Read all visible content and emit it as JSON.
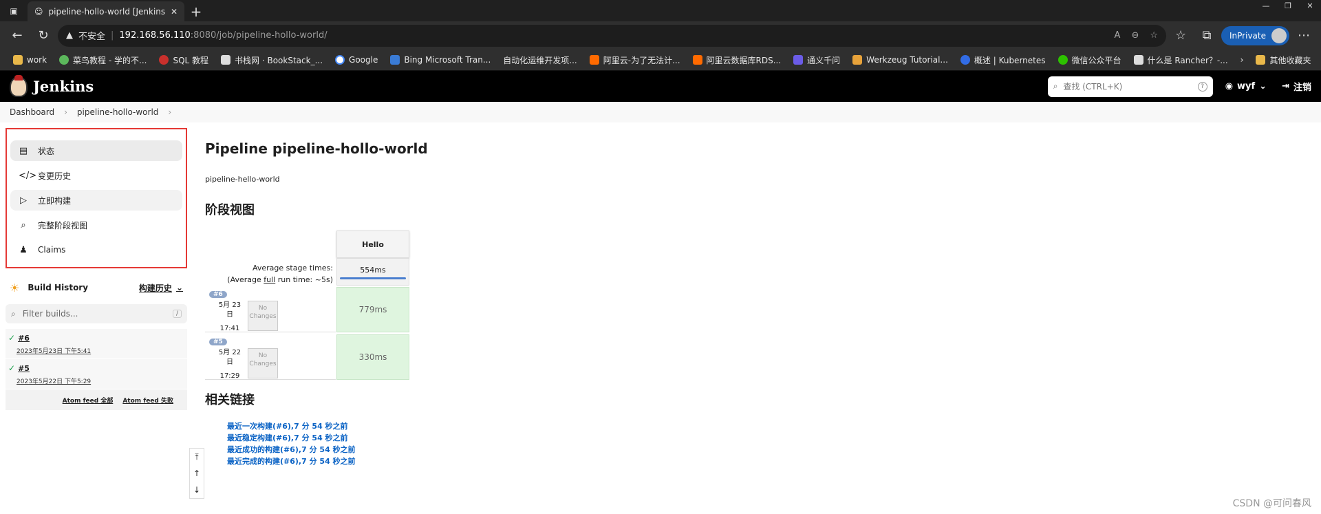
{
  "browser": {
    "tab_title": "pipeline-hollo-world [Jenkins]",
    "security_label": "不安全",
    "url_host": "192.168.56.110",
    "url_rest": ":8080/job/pipeline-hollo-world/",
    "inprivate": "InPrivate",
    "bookmarks": [
      "work",
      "菜鸟教程 - 学的不...",
      "SQL 教程",
      "书栈网 · BookStack_...",
      "Google",
      "Bing Microsoft Tran...",
      "自动化运维开发项...",
      "阿里云-为了无法计...",
      "阿里云数据库RDS...",
      "通义千问",
      "Werkzeug Tutorial...",
      "概述 | Kubernetes",
      "微信公众平台",
      "什么是 Rancher？-...",
      "其他收藏夹"
    ]
  },
  "header": {
    "logo_text": "Jenkins",
    "search_placeholder": "查找 (CTRL+K)",
    "user": "wyf",
    "logout": "注销"
  },
  "breadcrumb": [
    "Dashboard",
    "pipeline-hollo-world"
  ],
  "sidebar": {
    "tasks": [
      "状态",
      "变更历史",
      "立即构建",
      "完整阶段视图",
      "Claims"
    ],
    "build_history_title": "Build History",
    "trend_label": "构建历史",
    "filter_placeholder": "Filter builds...",
    "filter_key": "/",
    "builds": [
      {
        "num": "#6",
        "date": "2023年5月23日 下午5:41"
      },
      {
        "num": "#5",
        "date": "2023年5月22日 下午5:29"
      }
    ],
    "feed_all": "Atom feed 全部",
    "feed_fail": "Atom feed 失败"
  },
  "main": {
    "title": "Pipeline pipeline-hollo-world",
    "description": "pipeline-hello-world",
    "stage_view_title": "阶段视图",
    "stage_name": "Hello",
    "avg_label_1": "Average stage times:",
    "avg_label_2a": "(Average ",
    "avg_label_2b": "full",
    "avg_label_2c": " run time: ~5s)",
    "avg_value": "554ms",
    "rows": [
      {
        "num": "#6",
        "d1": "5月 23",
        "d2": "日",
        "time": "17:41",
        "changes": "No Changes",
        "dur": "779ms"
      },
      {
        "num": "#5",
        "d1": "5月 22",
        "d2": "日",
        "time": "17:29",
        "changes": "No Changes",
        "dur": "330ms"
      }
    ],
    "links_title": "相关链接",
    "links": [
      "最近一次构建(#6),7 分 54 秒之前",
      "最近稳定构建(#6),7 分 54 秒之前",
      "最近成功的构建(#6),7 分 54 秒之前",
      "最近完成的构建(#6),7 分 54 秒之前"
    ]
  },
  "watermark": "CSDN @可问春风"
}
